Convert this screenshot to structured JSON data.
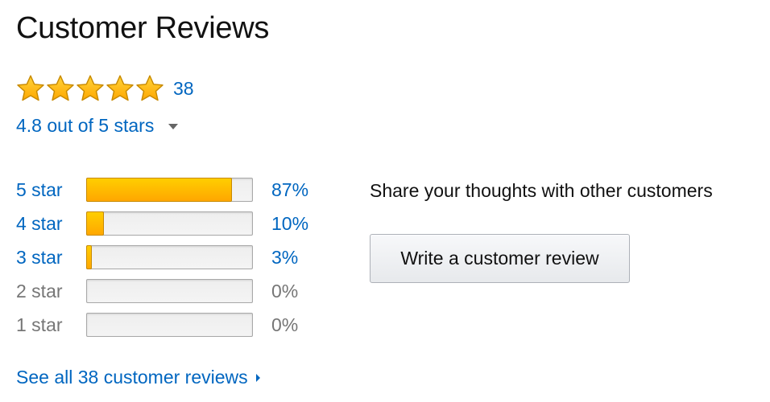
{
  "header": {
    "title": "Customer Reviews"
  },
  "summary": {
    "star_rating": 4.8,
    "star_icons": [
      "star-full-icon",
      "star-full-icon",
      "star-full-icon",
      "star-full-icon",
      "star-full-icon"
    ],
    "review_count": "38",
    "average_text": "4.8 out of 5 stars",
    "dropdown_icon": "caret-down-icon"
  },
  "histogram": {
    "rows": [
      {
        "label": "5 star",
        "percent_text": "87%",
        "percent": 87,
        "linked": true
      },
      {
        "label": "4 star",
        "percent_text": "10%",
        "percent": 10,
        "linked": true
      },
      {
        "label": "3 star",
        "percent_text": "3%",
        "percent": 3,
        "linked": true
      },
      {
        "label": "2 star",
        "percent_text": "0%",
        "percent": 0,
        "linked": false
      },
      {
        "label": "1 star",
        "percent_text": "0%",
        "percent": 0,
        "linked": false
      }
    ]
  },
  "share": {
    "prompt": "Share your thoughts with other customers",
    "button_label": "Write a customer review"
  },
  "footer": {
    "see_all_label": "See all 38 customer reviews",
    "arrow_icon": "caret-right-icon"
  },
  "colors": {
    "link": "#0066c0",
    "bar_fill_top": "#ffce00",
    "bar_fill_bottom": "#ffa700",
    "star": "#ffb500",
    "muted": "#767676"
  }
}
